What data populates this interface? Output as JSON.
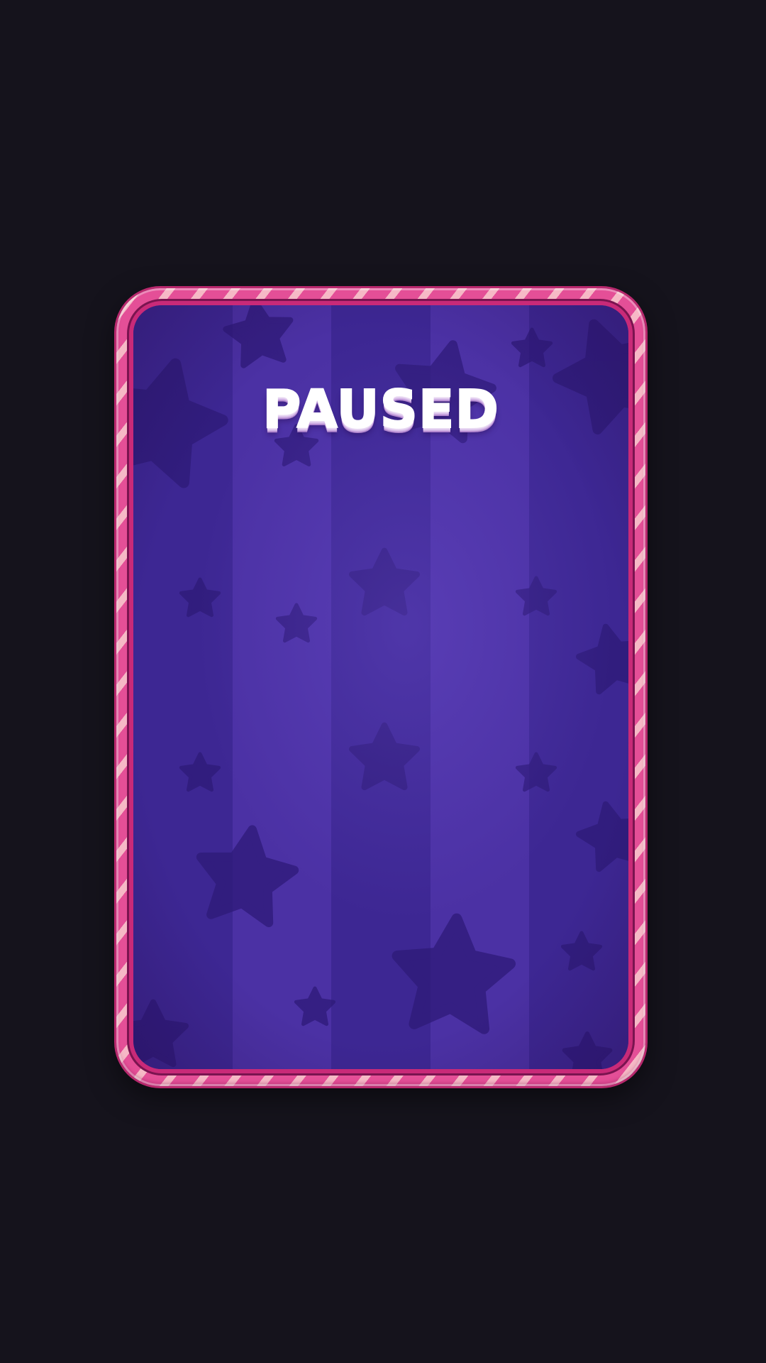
{
  "pause_dialog": {
    "title": "PAUSED"
  },
  "colors": {
    "background": "#15131c",
    "frame_pink": "#e44f97",
    "frame_stripe": "#f6b9c6",
    "panel_purple": "#41299a",
    "star": "#2e1a78",
    "title_text": "#ffffff"
  },
  "icons": {
    "background_decoration": "star-icon"
  }
}
